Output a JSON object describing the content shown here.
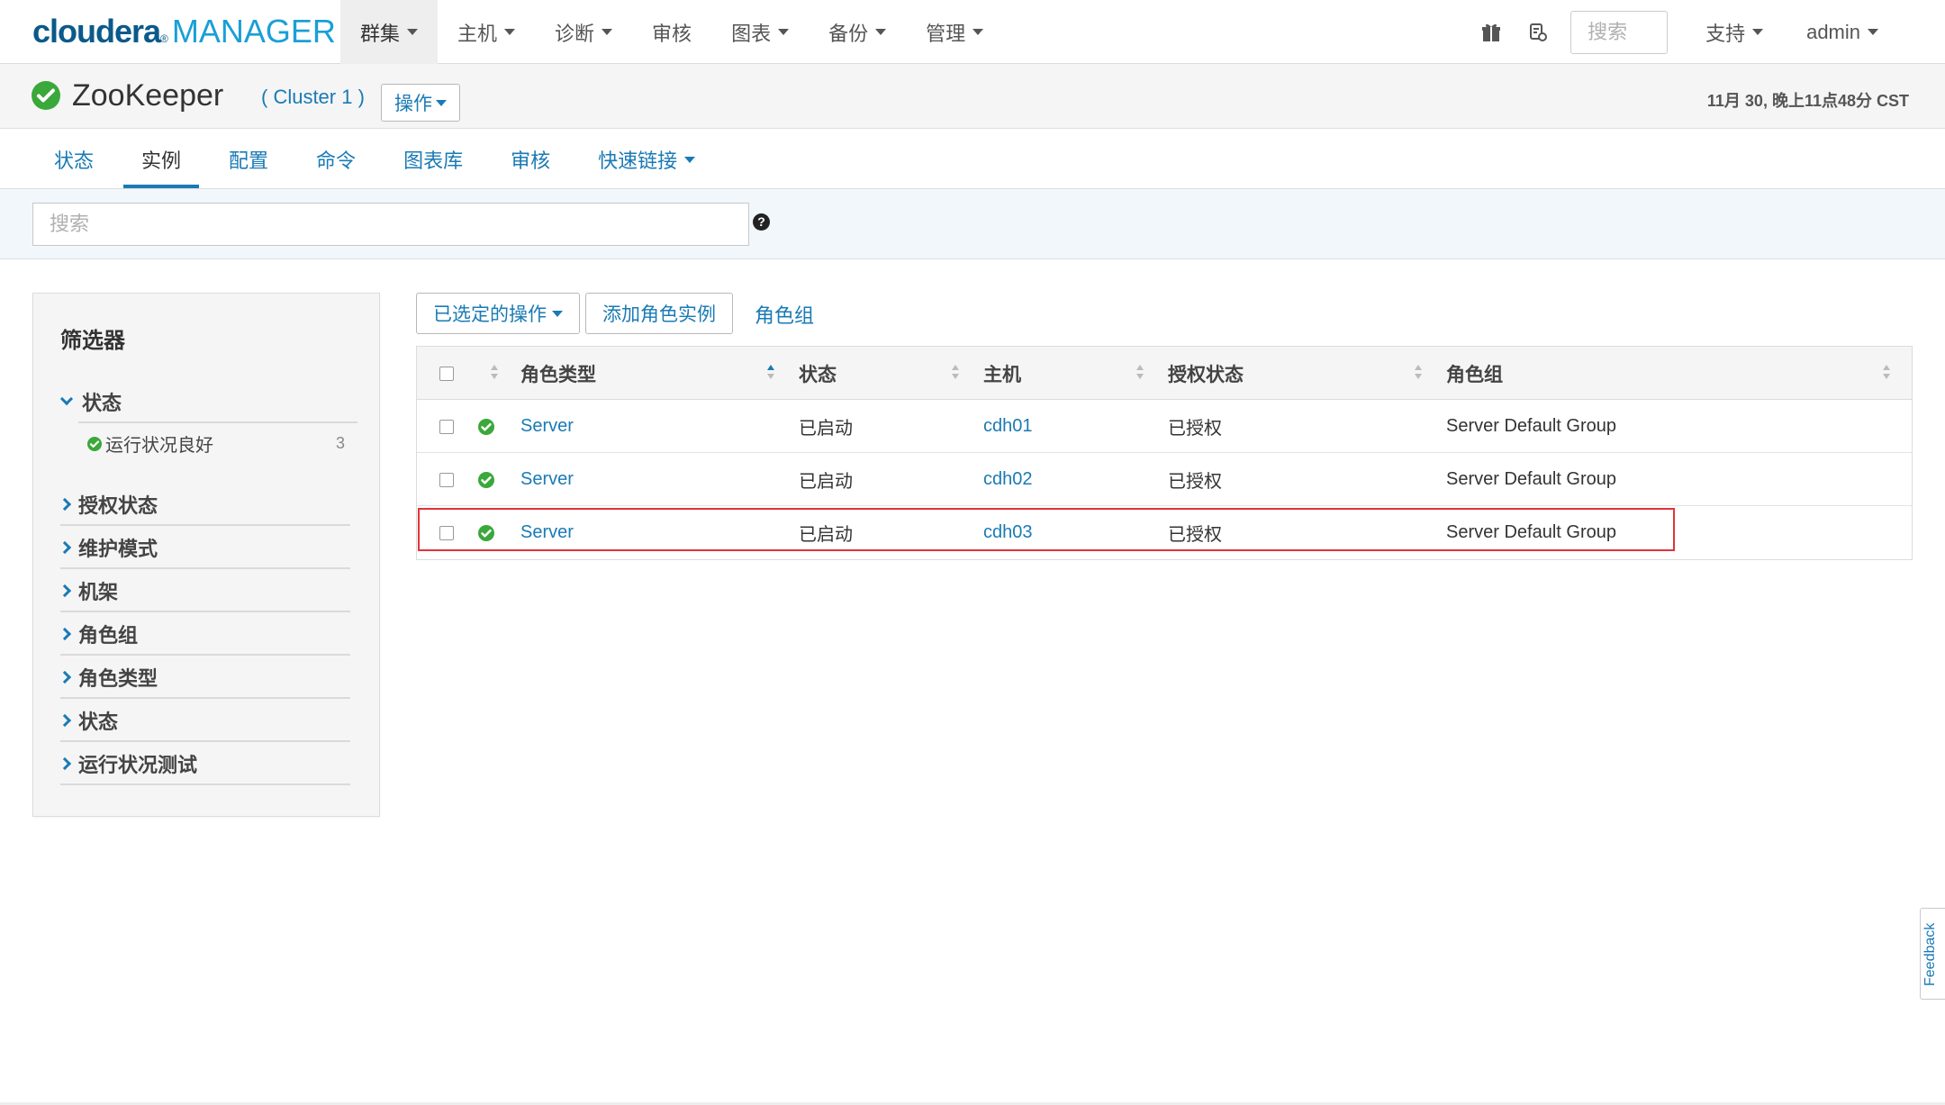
{
  "topnav": {
    "logo_brand": "cloudera",
    "logo_product": "MANAGER",
    "items": [
      {
        "label": "群集",
        "caret": true,
        "active": true
      },
      {
        "label": "主机",
        "caret": true
      },
      {
        "label": "诊断",
        "caret": true
      },
      {
        "label": "审核",
        "caret": false
      },
      {
        "label": "图表",
        "caret": true
      },
      {
        "label": "备份",
        "caret": true
      },
      {
        "label": "管理",
        "caret": true
      }
    ],
    "search_placeholder": "搜索",
    "support_label": "支持",
    "user_label": "admin",
    "icons": [
      "gift-icon",
      "parcel-icon"
    ]
  },
  "header": {
    "service_name": "ZooKeeper",
    "cluster_label": "( Cluster 1 )",
    "actions_label": "操作",
    "timestamp": "11月 30, 晚上11点48分 CST",
    "status_color": "#3aa83a"
  },
  "tabs": [
    {
      "label": "状态",
      "active": false
    },
    {
      "label": "实例",
      "active": true
    },
    {
      "label": "配置",
      "active": false
    },
    {
      "label": "命令",
      "active": false
    },
    {
      "label": "图表库",
      "active": false
    },
    {
      "label": "审核",
      "active": false
    },
    {
      "label": "快速链接",
      "active": false,
      "caret": true
    }
  ],
  "search": {
    "placeholder": "搜索",
    "help": "?"
  },
  "filters": {
    "title": "筛选器",
    "status_group": "状态",
    "status_item": {
      "label": "运行状况良好",
      "count": "3"
    },
    "groups": [
      "授权状态",
      "维护模式",
      "机架",
      "角色组",
      "角色类型",
      "状态",
      "运行状况测试"
    ]
  },
  "actions": {
    "selected_ops": "已选定的操作",
    "add_role": "添加角色实例",
    "role_groups": "角色组"
  },
  "table": {
    "headers": [
      "角色类型",
      "状态",
      "主机",
      "授权状态",
      "角色组"
    ],
    "rows": [
      {
        "role_type": "Server",
        "state": "已启动",
        "host": "cdh01",
        "auth": "已授权",
        "group": "Server Default Group"
      },
      {
        "role_type": "Server",
        "state": "已启动",
        "host": "cdh02",
        "auth": "已授权",
        "group": "Server Default Group"
      },
      {
        "role_type": "Server",
        "state": "已启动",
        "host": "cdh03",
        "auth": "已授权",
        "group": "Server Default Group"
      }
    ],
    "highlight_row": 2,
    "highlight_color": "#e0343a"
  },
  "feedback_label": "Feedback",
  "colors": {
    "accent": "#1a7ab5",
    "ok": "#3aa83a"
  }
}
